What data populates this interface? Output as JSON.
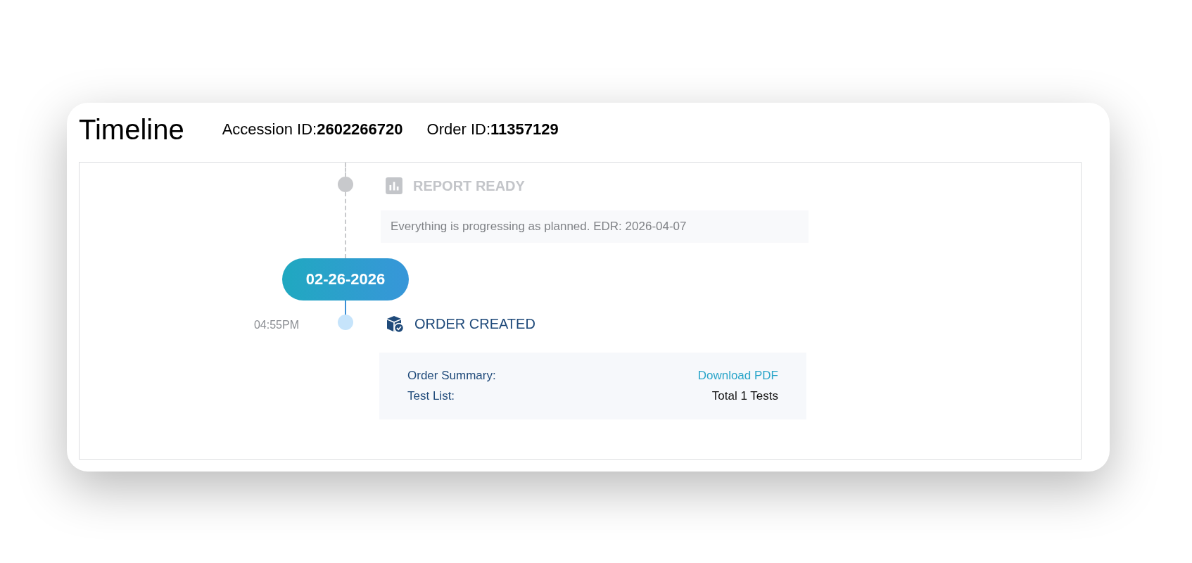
{
  "header": {
    "title": "Timeline",
    "ids": [
      {
        "label": "Accession ID:",
        "value": "2602266720"
      },
      {
        "label": "Order ID:",
        "value": "11357129"
      }
    ]
  },
  "timeline": [
    {
      "kind": "report",
      "completed": false,
      "title": "REPORT READY",
      "note": "Everything is progressing as planned. EDR: 2026-04-07"
    },
    {
      "kind": "date",
      "label": "02-26-2026"
    },
    {
      "kind": "order",
      "completed": true,
      "time": "04:55PM",
      "title": "ORDER CREATED",
      "details": [
        {
          "kind": "link",
          "label": "Order Summary:",
          "value": "Download PDF"
        },
        {
          "kind": "text",
          "label": "Test List:",
          "value": "Total 1 Tests"
        }
      ]
    }
  ]
}
